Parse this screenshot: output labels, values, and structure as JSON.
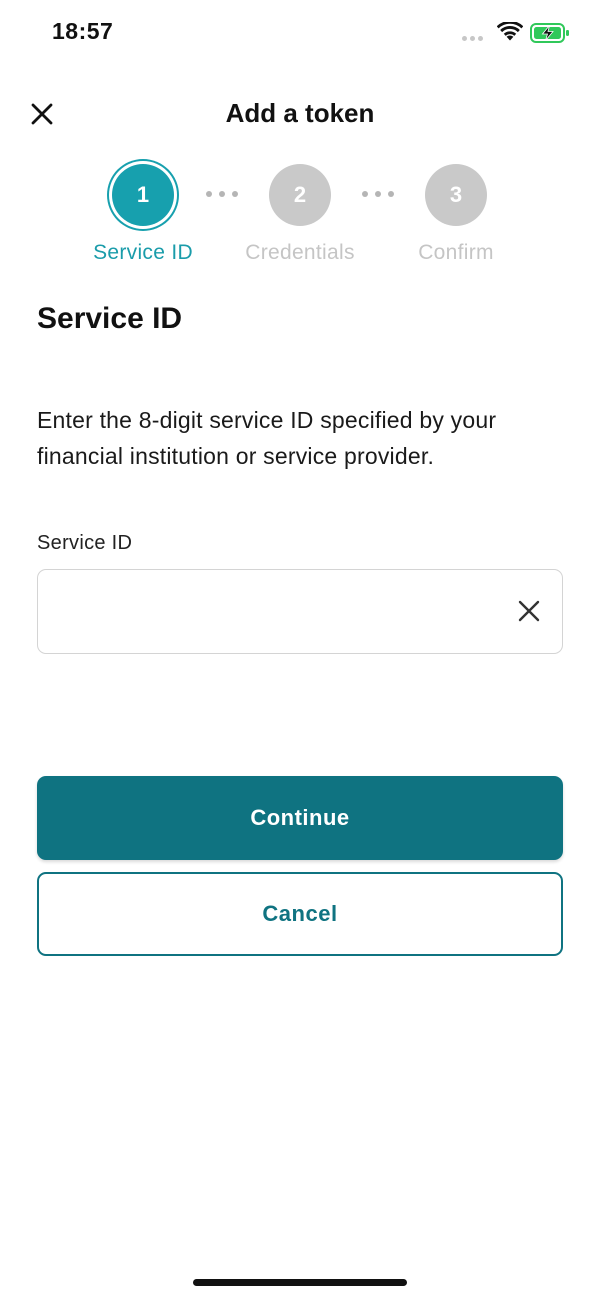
{
  "status_bar": {
    "time": "18:57",
    "icons": [
      "signal-icon",
      "wifi-icon",
      "battery-charging-icon"
    ],
    "battery_color": "#30c85a"
  },
  "header": {
    "title": "Add a token",
    "close_icon": "close-icon"
  },
  "stepper": {
    "accent_color": "#17a0ae",
    "inactive_color": "#c9c9c9",
    "steps": [
      {
        "number": "1",
        "label": "Service ID",
        "active": true
      },
      {
        "number": "2",
        "label": "Credentials",
        "active": false
      },
      {
        "number": "3",
        "label": "Confirm",
        "active": false
      }
    ]
  },
  "main": {
    "section_title": "Service ID",
    "description": "Enter the 8-digit service ID specified by your financial institution or service provider.",
    "field": {
      "label": "Service ID",
      "value": "",
      "placeholder": "",
      "clear_icon": "clear-icon"
    }
  },
  "actions": {
    "continue_label": "Continue",
    "cancel_label": "Cancel",
    "primary_color": "#0f7381"
  }
}
